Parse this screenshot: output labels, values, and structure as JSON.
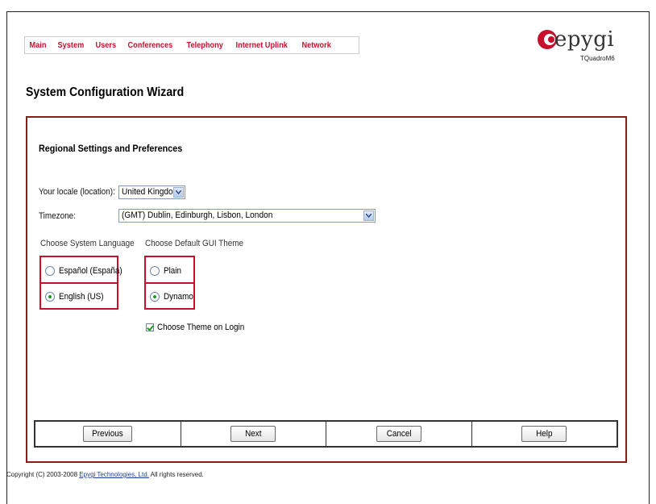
{
  "nav": {
    "items": [
      "Main",
      "System",
      "Users",
      "Conferences",
      "Telephony",
      "Internet Uplink",
      "Network"
    ]
  },
  "logo": {
    "brand": "epygi",
    "model": "TQuadroM6"
  },
  "page_title": "System Configuration Wizard",
  "section_title": "Regional Settings and Preferences",
  "locale": {
    "label": "Your locale (location):",
    "value": "United Kingdom"
  },
  "timezone": {
    "label": "Timezone:",
    "value": "(GMT) Dublin, Edinburgh, Lisbon, London"
  },
  "language": {
    "heading": "Choose System Language",
    "options": [
      {
        "label": "Español (España)",
        "checked": false
      },
      {
        "label": "English (US)",
        "checked": true
      }
    ]
  },
  "theme": {
    "heading": "Choose Default GUI Theme",
    "options": [
      {
        "label": "Plain",
        "checked": false
      },
      {
        "label": "Dynamo",
        "checked": true
      }
    ],
    "login_checkbox": {
      "label": "Choose Theme on Login",
      "checked": true
    }
  },
  "buttons": {
    "previous": "Previous",
    "next": "Next",
    "cancel": "Cancel",
    "help": "Help"
  },
  "footer": {
    "copyright_prefix": "Copyright (C) 2003-2008 ",
    "company_link": "Epygi Technologies, Ltd.",
    "copyright_suffix": " All rights reserved."
  },
  "colors": {
    "nav_text": "#c8102e",
    "highlight_border": "#c8102e",
    "panel_border": "#8b1a1a",
    "radio_check": "#1f9b1f"
  }
}
